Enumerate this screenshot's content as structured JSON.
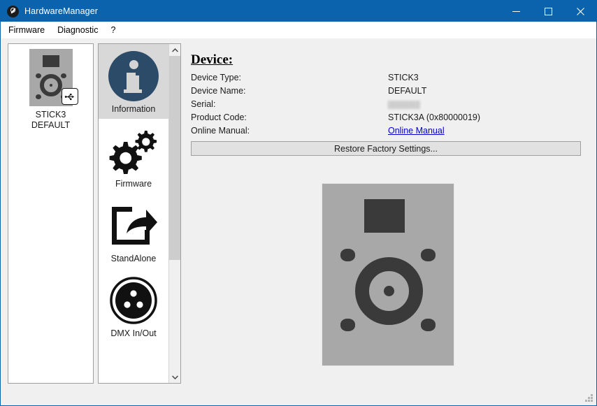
{
  "window": {
    "title": "HardwareManager",
    "icon": "wrench-circle-icon",
    "minimize_label": "–",
    "maximize_label": "□",
    "close_label": "✕"
  },
  "menubar": {
    "items": [
      {
        "label": "Firmware"
      },
      {
        "label": "Diagnostic"
      },
      {
        "label": "?"
      }
    ]
  },
  "device_list": {
    "devices": [
      {
        "name_line1": "STICK3",
        "name_line2": "DEFAULT",
        "connection_badge": "usb-icon"
      }
    ]
  },
  "nav": {
    "items": [
      {
        "label": "Information",
        "icon": "info-icon",
        "selected": true
      },
      {
        "label": "Firmware",
        "icon": "gears-icon",
        "selected": false
      },
      {
        "label": "StandAlone",
        "icon": "export-arrow-icon",
        "selected": false
      },
      {
        "label": "DMX In/Out",
        "icon": "xlr-connector-icon",
        "selected": false
      }
    ],
    "scroll_up": "∧",
    "scroll_down": "∨"
  },
  "content": {
    "heading": "Device:",
    "rows": [
      {
        "label": "Device Type:",
        "value": "STICK3"
      },
      {
        "label": "Device Name:",
        "value": "DEFAULT"
      },
      {
        "label": "Serial:",
        "value": ""
      },
      {
        "label": "Product Code:",
        "value": "STICK3A (0x80000019)"
      },
      {
        "label": "Online Manual:",
        "value": "Online Manual"
      }
    ],
    "restore_button": "Restore Factory Settings...",
    "preview_alt": "STICK3 device front panel"
  },
  "colors": {
    "titlebar": "#0a63ac",
    "accent_info_icon": "#2b4b68",
    "link": "#0000cc",
    "device_body": "#a8a8a8",
    "device_detail": "#3a3a3a"
  }
}
